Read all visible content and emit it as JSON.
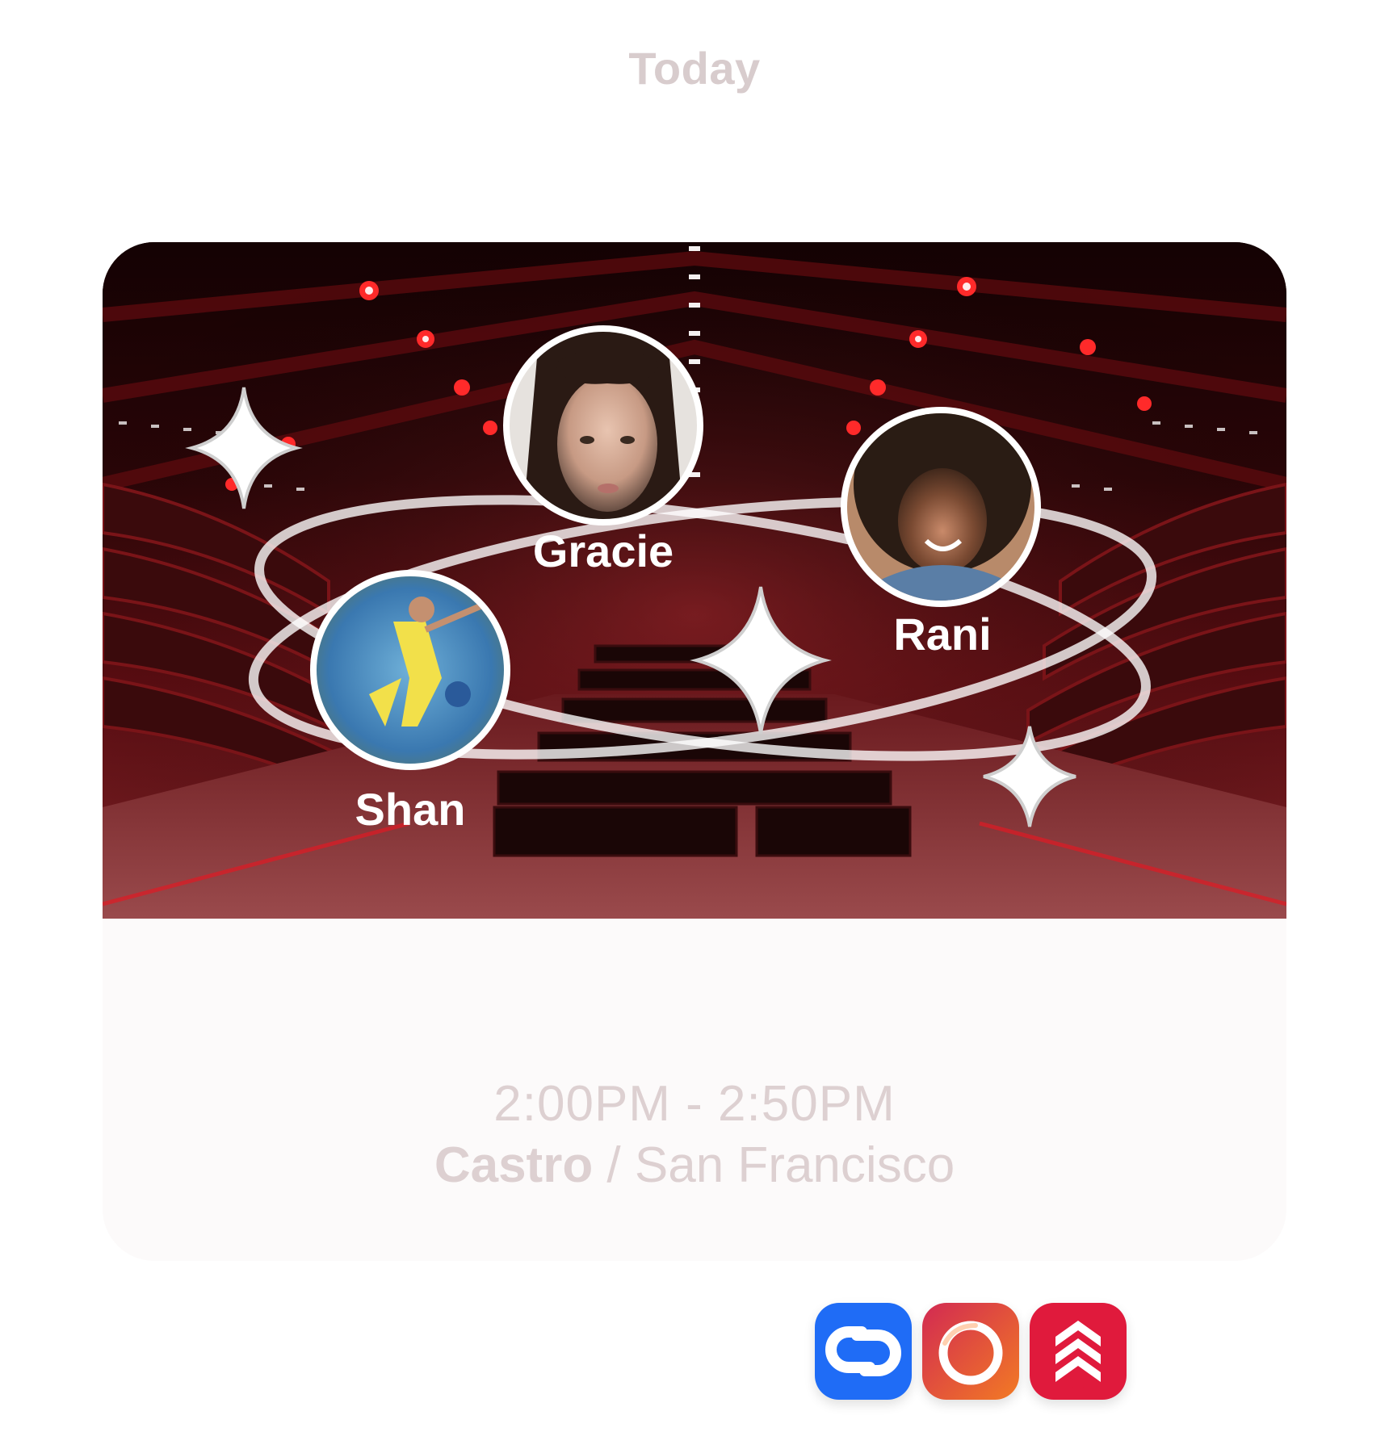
{
  "header": {
    "date_label": "Today"
  },
  "event_card": {
    "participants": [
      {
        "name": "Gracie",
        "avatar_icon": "woman-portrait-avatar"
      },
      {
        "name": "Rani",
        "avatar_icon": "laughing-person-avatar"
      },
      {
        "name": "Shan",
        "avatar_icon": "soccer-player-avatar"
      }
    ],
    "time_range": "2:00PM - 2:50PM",
    "location_venue": "Castro",
    "location_separator": " / ",
    "location_city": "San Francisco"
  },
  "app_icons": [
    {
      "name": "link-app-icon",
      "color": "#1f6cf6"
    },
    {
      "name": "ring-app-icon",
      "color": "#e8453c"
    },
    {
      "name": "chevron-star-app-icon",
      "color": "#e01a3c"
    }
  ],
  "colors": {
    "header_text": "#d8cccd",
    "card_background": "#fcfafa",
    "hero_red": "#c4151f",
    "muted_text": "#ddd0d1"
  }
}
